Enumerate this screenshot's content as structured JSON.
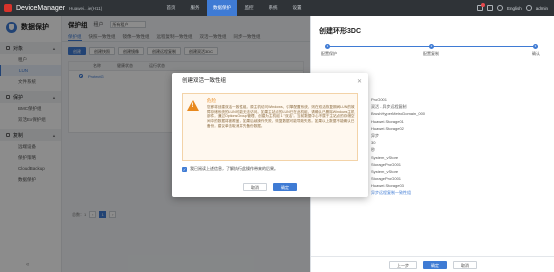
{
  "topbar": {
    "brand": "DeviceManager",
    "subtitle": "Huawei...ie(H11)",
    "nav": [
      "首页",
      "服务",
      "数据保护",
      "监控",
      "系统",
      "设置"
    ],
    "active_nav": "数据保护",
    "lang": "English",
    "user": "admin"
  },
  "sidebar": {
    "title": "数据保护",
    "groups": [
      {
        "label": "对象",
        "items": [
          "租户",
          "LUN",
          "文件系统"
        ]
      },
      {
        "label": "保护",
        "items": [
          "BMC保护组",
          "双活Ex保护组"
        ]
      },
      {
        "label": "复制",
        "items": [
          "远端设备",
          "保护策略",
          "CloudBackup",
          "数据保护"
        ]
      }
    ],
    "active_item": "LUN",
    "collapse": "«"
  },
  "main": {
    "title": "保护组",
    "tenant_label": "租户",
    "tenant_value": "所有租户",
    "tabs": [
      "保护组",
      "快照一致性组",
      "镜像一致性组",
      "远程复制一致性组",
      "双活一致性组",
      "同步一致性组"
    ],
    "toolbar": [
      "创建",
      "创建快照",
      "创建镜像",
      "创建远程复制",
      "创建双活3DC"
    ],
    "columns": [
      "名称",
      "健康状态",
      "运行状态"
    ],
    "row": "ProtectG",
    "pager": {
      "total": "总数：1",
      "page": "1",
      "prev": "‹",
      "next": "›"
    }
  },
  "drawer": {
    "title": "创建环形3DC",
    "steps": [
      {
        "n": "1",
        "label": "配置保护"
      },
      {
        "n": "2",
        "label": "配置复制"
      },
      {
        "n": "3",
        "label": "确认"
      }
    ],
    "info": [
      "ProG001",
      "双活 - 异步远程复制",
      "BrushHyperMetroDomain_000",
      "Huawei.Storage01",
      "Huawei.Storage02",
      "异步",
      "30",
      "秒",
      "System_vStore",
      "StorageProG001",
      "System_vStore",
      "StorageProG001",
      "Huawei.Storage03",
      "异步远程复制一致性组"
    ],
    "buttons": {
      "prev": "上一步",
      "next": "确定",
      "cancel": "取消"
    }
  },
  "modal": {
    "title": "创建双活一致性组",
    "close": "✕",
    "warn_label": "危险",
    "warn_text": "您即将创建双活一致性组。原主机访问Windows、引擎配置系统，则在双活恢复期间LUN的故障存储系统的LUN可能无法访问。如果主站点的LUN已在此机组，请确认已删除Windows主机部件，通过OptionsGroup管理、创建为主机组 1 \"双活\"。当前数据中心不属于主站点的存储空间中的数据将被覆盖，如果后续操作失败，恢复数据可能导致失败。如果以上数据不能确认已备份，建议单击取消并先备份数据。",
    "check_label": "我已阅读上述信息，了解执行此操作带来的后果。",
    "cancel": "取消",
    "ok": "确定"
  },
  "colors": {
    "accent": "#3f7bd4",
    "warn": "#e8891e",
    "topbar": "#2f3337"
  }
}
